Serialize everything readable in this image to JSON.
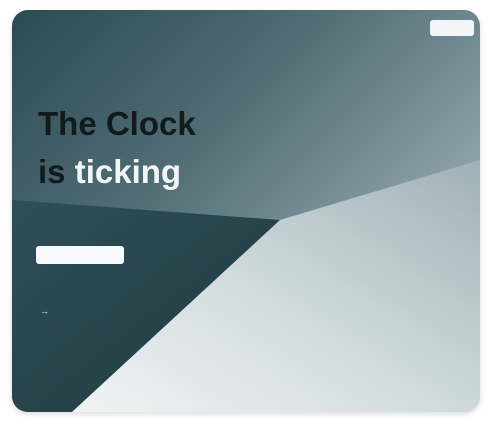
{
  "brand": {
    "logo": ""
  },
  "nav": {
    "links": [
      "",
      "",
      "",
      "",
      "",
      ""
    ],
    "cta_label": ""
  },
  "hero": {
    "headline_line1": "The Clock",
    "headline_word_is": "is",
    "headline_accent": "ticking",
    "button_label": ""
  },
  "stats": [
    {
      "value": "",
      "arrow_icon": "arrow-right-icon"
    },
    {
      "value": ""
    }
  ],
  "colors": {
    "dark_teal": "#2b4a52",
    "light_gray": "#b9c7cb",
    "headline_dark": "#111a1d",
    "accent_white": "#f3f6f7"
  }
}
